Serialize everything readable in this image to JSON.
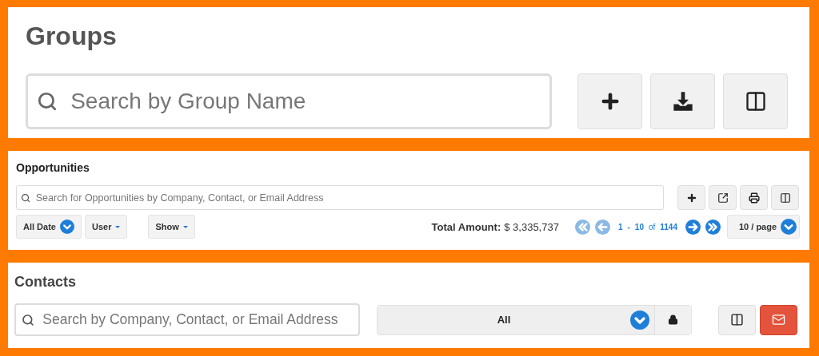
{
  "groups": {
    "title": "Groups",
    "search": {
      "placeholder": "Search by Group Name"
    },
    "buttons": [
      {
        "kind": "add"
      },
      {
        "kind": "download"
      },
      {
        "kind": "columns"
      }
    ]
  },
  "opportunities": {
    "title": "Opportunities",
    "search": {
      "placeholder": "Search for Opportunities by Company, Contact, or Email Address"
    },
    "buttons": [
      {
        "kind": "add"
      },
      {
        "kind": "export"
      },
      {
        "kind": "print"
      },
      {
        "kind": "columns"
      }
    ],
    "filters": [
      {
        "label": "All Date",
        "kind": "circle"
      },
      {
        "label": "User",
        "kind": "caret"
      },
      {
        "label": "Show",
        "kind": "caret"
      }
    ],
    "total": {
      "label": "Total Amount:",
      "value": "$ 3,335,737"
    },
    "pager": {
      "buttons": [
        {
          "kind": "first",
          "disabled": true
        },
        {
          "kind": "prev",
          "disabled": true
        },
        {
          "kind": "next",
          "disabled": false
        },
        {
          "kind": "last",
          "disabled": false
        }
      ],
      "from": "1",
      "separator": "-",
      "to": "10",
      "of": "of",
      "count": "1144"
    },
    "page_size": "10 / page"
  },
  "contacts": {
    "title": "Contacts",
    "search": {
      "placeholder": "Search by Company, Contact, or Email Address"
    },
    "select": {
      "value": "All"
    },
    "buttons": [
      {
        "kind": "columns"
      },
      {
        "kind": "email"
      }
    ]
  }
}
